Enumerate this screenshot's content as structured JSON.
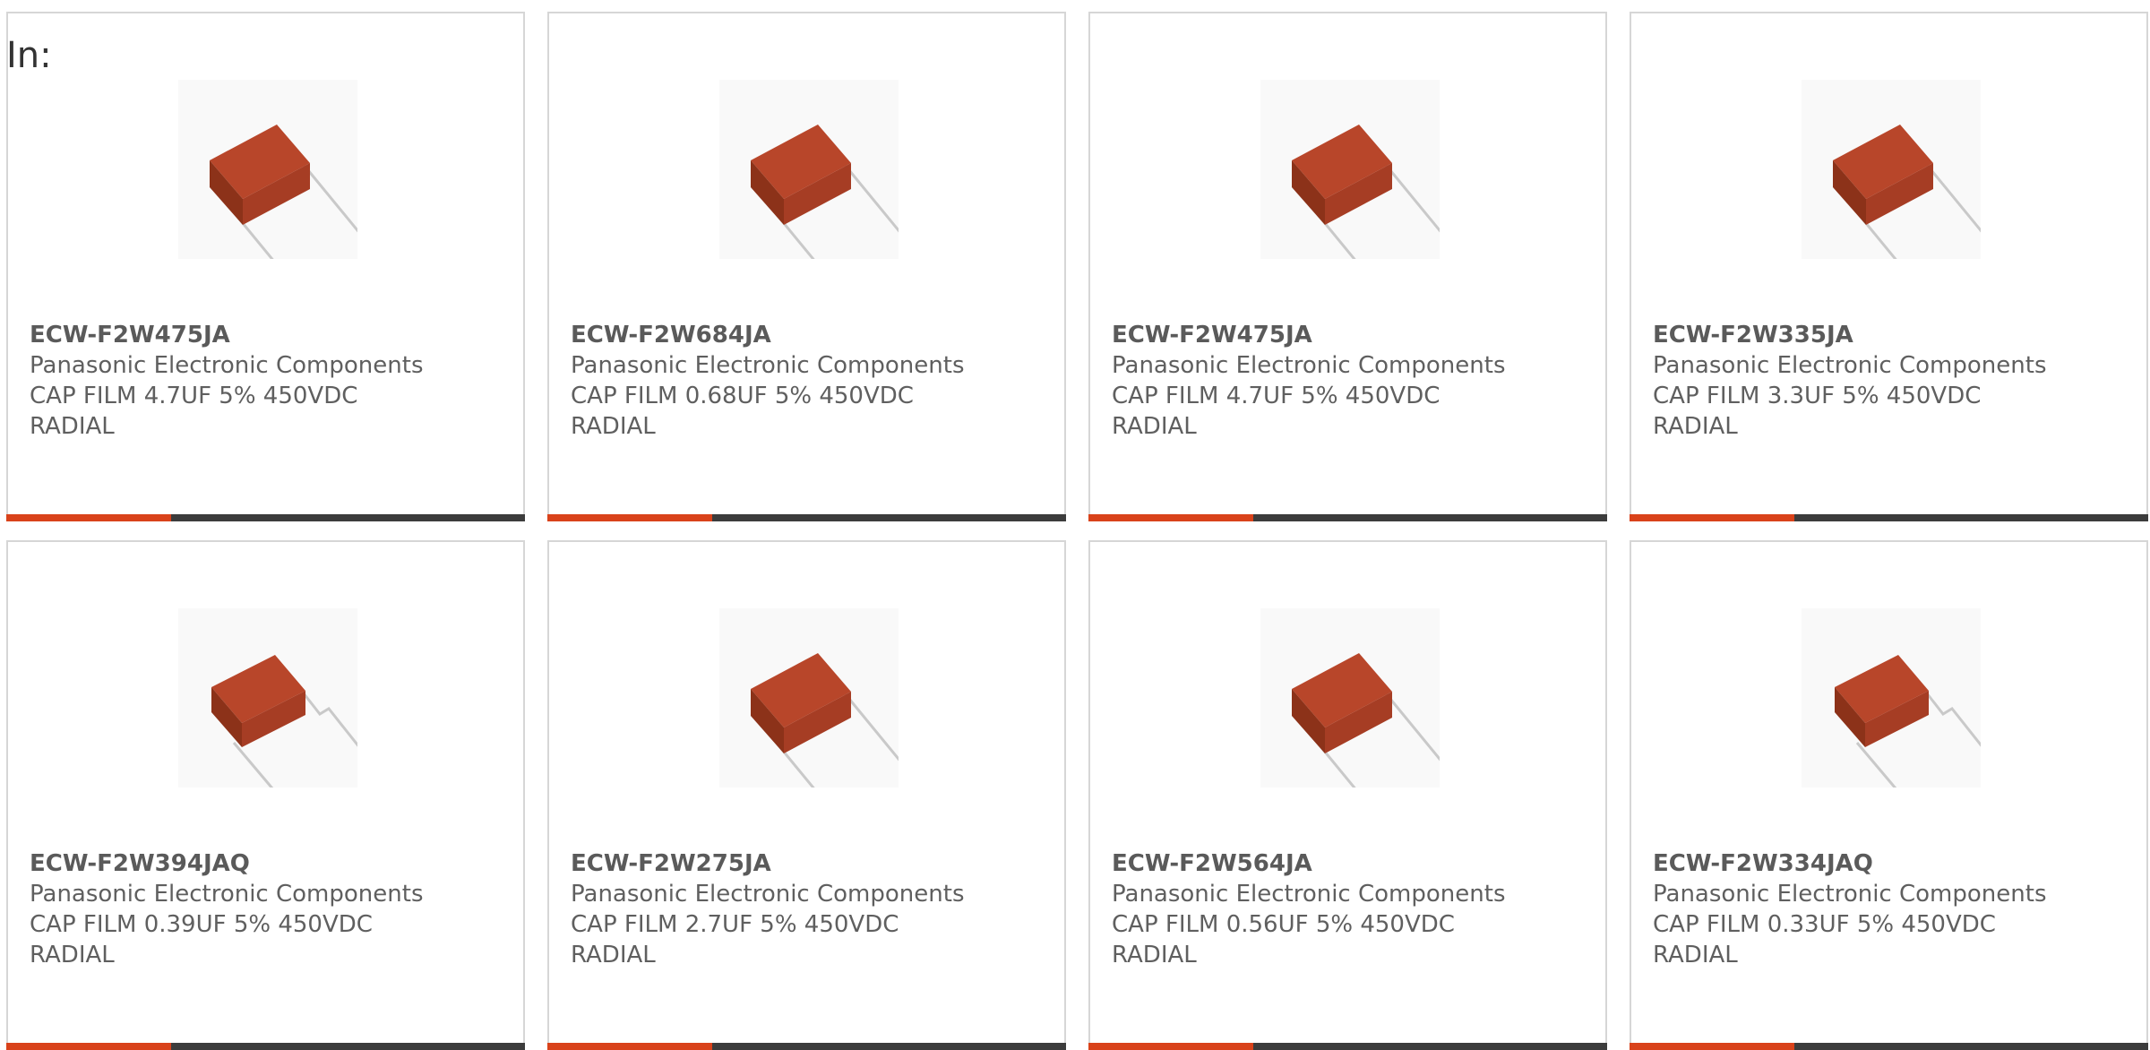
{
  "filter": {
    "label": "In:"
  },
  "colors": {
    "accent": "#d9421a",
    "bar": "#3c3c3c",
    "border": "#d6d6d6",
    "body": "#f9f9f9",
    "capacitor": "#a63d24"
  },
  "products": [
    {
      "part_number": "ECW-F2W475JA",
      "manufacturer": "Panasonic Electronic Components",
      "desc_line1": "CAP FILM 4.7UF 5% 450VDC",
      "desc_line2": "RADIAL",
      "image_icon": "film-capacitor-icon"
    },
    {
      "part_number": "ECW-F2W684JA",
      "manufacturer": "Panasonic Electronic Components",
      "desc_line1": "CAP FILM 0.68UF 5% 450VDC",
      "desc_line2": "RADIAL",
      "image_icon": "film-capacitor-icon"
    },
    {
      "part_number": "ECW-F2W475JA",
      "manufacturer": "Panasonic Electronic Components",
      "desc_line1": "CAP FILM 4.7UF 5% 450VDC",
      "desc_line2": "RADIAL",
      "image_icon": "film-capacitor-icon"
    },
    {
      "part_number": "ECW-F2W335JA",
      "manufacturer": "Panasonic Electronic Components",
      "desc_line1": "CAP FILM 3.3UF 5% 450VDC",
      "desc_line2": "RADIAL",
      "image_icon": "film-capacitor-icon"
    },
    {
      "part_number": "ECW-F2W394JAQ",
      "manufacturer": "Panasonic Electronic Components",
      "desc_line1": "CAP FILM 0.39UF 5% 450VDC",
      "desc_line2": "RADIAL",
      "image_icon": "film-capacitor-bent-lead-icon"
    },
    {
      "part_number": "ECW-F2W275JA",
      "manufacturer": "Panasonic Electronic Components",
      "desc_line1": "CAP FILM 2.7UF 5% 450VDC",
      "desc_line2": "RADIAL",
      "image_icon": "film-capacitor-icon"
    },
    {
      "part_number": "ECW-F2W564JA",
      "manufacturer": "Panasonic Electronic Components",
      "desc_line1": "CAP FILM 0.56UF 5% 450VDC",
      "desc_line2": "RADIAL",
      "image_icon": "film-capacitor-icon"
    },
    {
      "part_number": "ECW-F2W334JAQ",
      "manufacturer": "Panasonic Electronic Components",
      "desc_line1": "CAP FILM 0.33UF 5% 450VDC",
      "desc_line2": "RADIAL",
      "image_icon": "film-capacitor-bent-lead-icon"
    }
  ]
}
